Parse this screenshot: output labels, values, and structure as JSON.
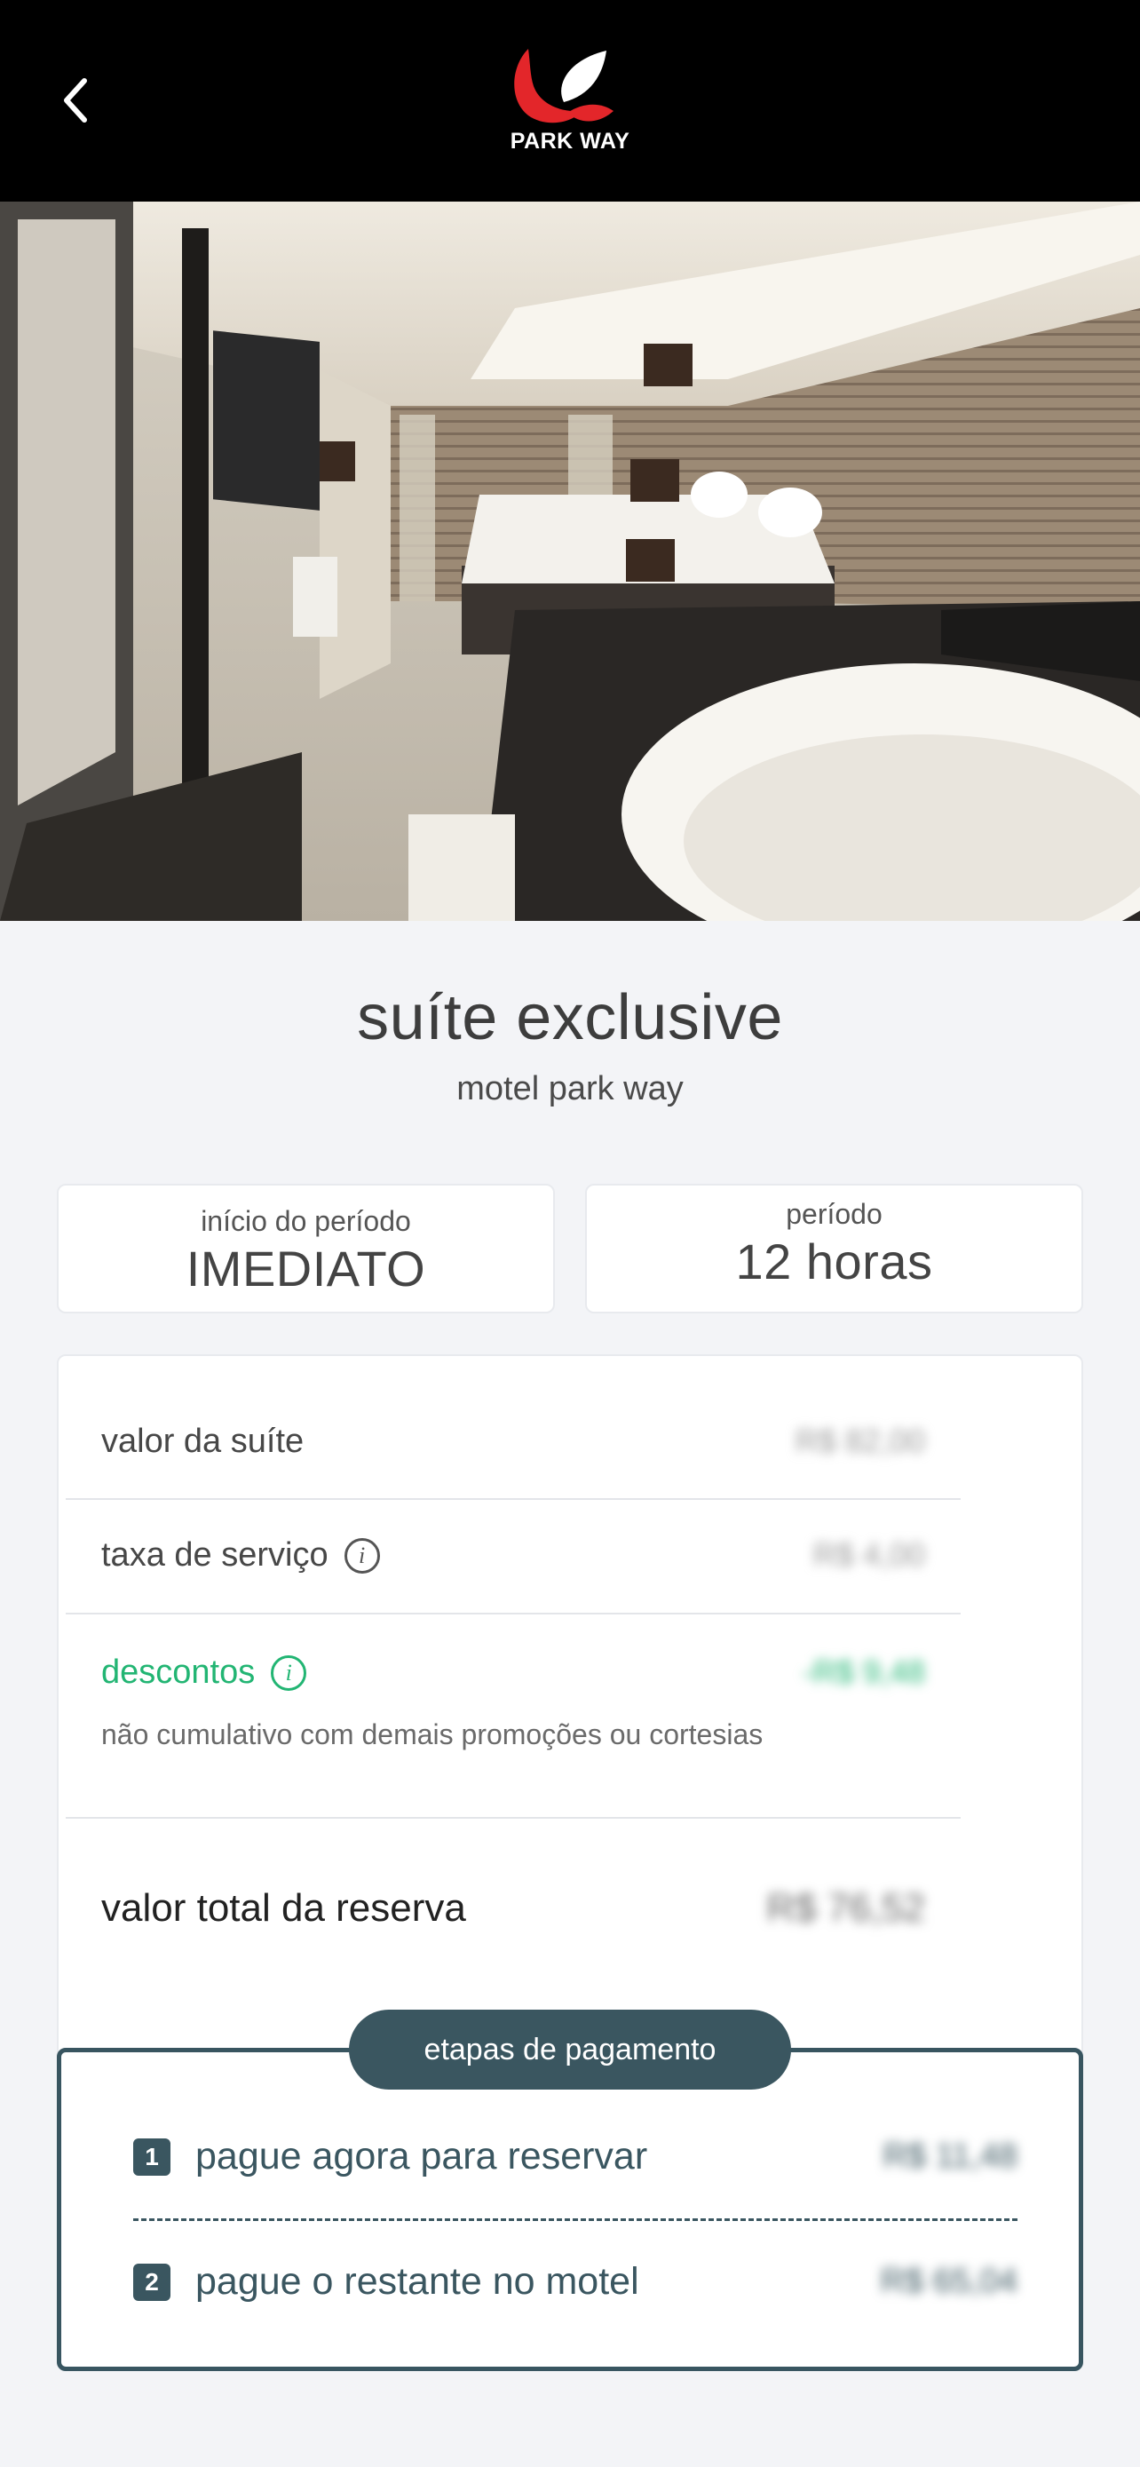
{
  "brand": {
    "name": "PARK WAY",
    "logo_icon": "parkway-leaf-logo",
    "accent": "#e3262a"
  },
  "header": {
    "back_icon": "chevron-left-icon"
  },
  "gallery": {
    "total_images": 12,
    "active_index": 0
  },
  "suite": {
    "title": "suíte exclusive",
    "motel": "motel park way"
  },
  "period_start": {
    "label": "início do período",
    "value": "IMEDIATO"
  },
  "period_length": {
    "label": "período",
    "value": "12 horas"
  },
  "pricing": {
    "suite_label": "valor da suíte",
    "suite_value": "R$ 82,00",
    "fee_label": "taxa de serviço",
    "fee_value": "R$ 4,00",
    "discount_label": "descontos",
    "discount_value": "-R$ 9,48",
    "discount_note": "não cumulativo com demais promoções ou cortesias",
    "total_label": "valor total da reserva",
    "total_value": "R$ 76,52"
  },
  "payment_steps": {
    "title": "etapas de pagamento",
    "steps": [
      {
        "number": "1",
        "label": "pague agora para reservar",
        "value": "R$ 11,48"
      },
      {
        "number": "2",
        "label": "pague o restante no motel",
        "value": "R$ 65,04"
      }
    ]
  },
  "colors": {
    "steps_primary": "#3a5660",
    "discount_green": "#22b573"
  }
}
